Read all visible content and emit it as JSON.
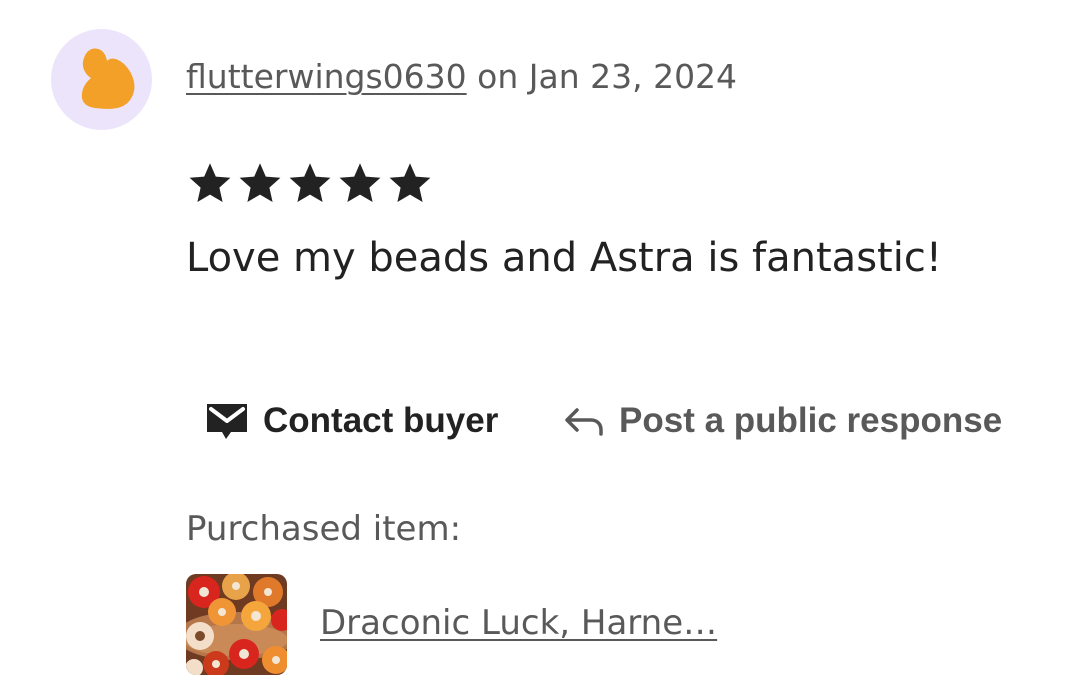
{
  "review": {
    "username": "flutterwings0630",
    "date_text": " on Jan 23, 2024",
    "rating": 5,
    "rating_max": 5,
    "text": "Love my beads and Astra is fantastic!"
  },
  "actions": {
    "contact_label": "Contact buyer",
    "contact_icon": "mail-icon",
    "response_label": "Post a public response",
    "response_icon": "reply-arrow-icon"
  },
  "purchased": {
    "label": "Purchased item:",
    "item_title": "Draconic Luck, Harne…"
  },
  "colors": {
    "avatar_bg": "#ece4fb",
    "avatar_figure": "#f3a028",
    "text_primary": "#222222",
    "text_secondary": "#595959"
  }
}
